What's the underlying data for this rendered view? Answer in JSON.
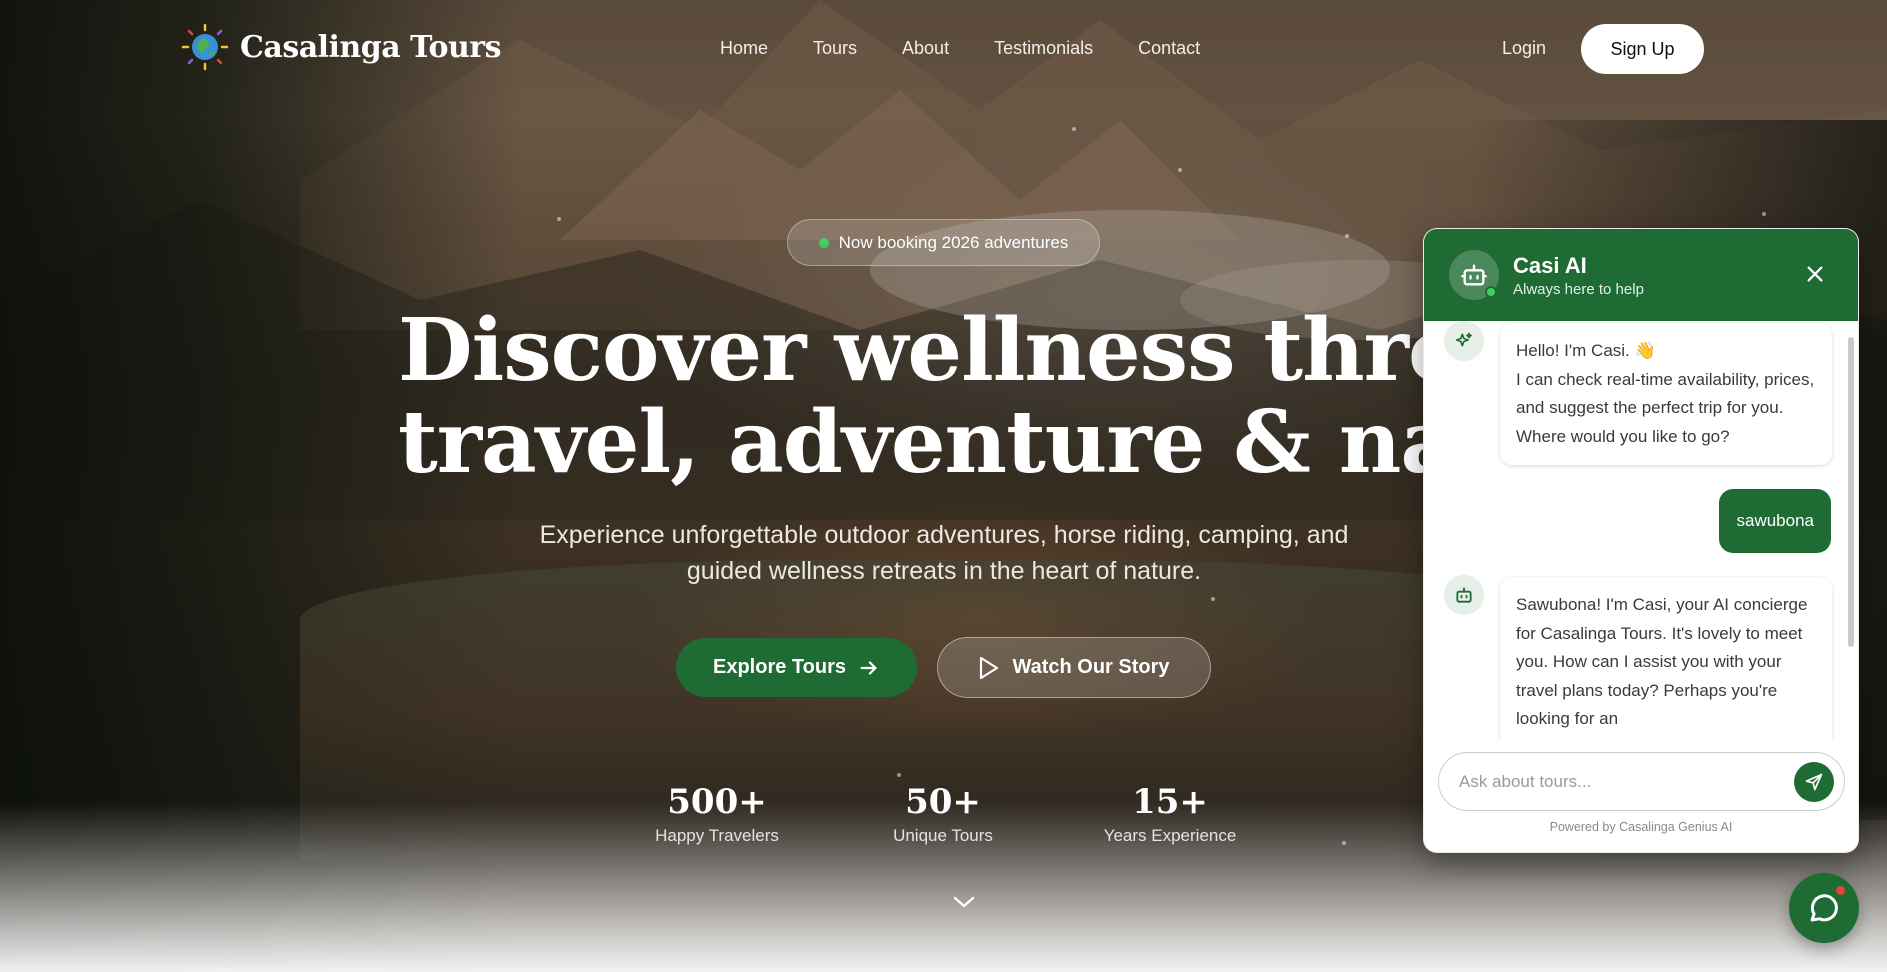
{
  "brand": {
    "name": "Casalinga Tours"
  },
  "nav": {
    "items": [
      "Home",
      "Tours",
      "About",
      "Testimonials",
      "Contact"
    ]
  },
  "auth": {
    "login": "Login",
    "signup": "Sign Up"
  },
  "hero": {
    "badge": "Now booking 2026 adventures",
    "title_line1": "Discover wellness through",
    "title_line2": "travel, adventure & nature",
    "subtitle": "Experience unforgettable outdoor adventures, horse riding, camping, and guided wellness retreats in the heart of nature.",
    "cta_primary": "Explore Tours",
    "cta_secondary": "Watch Our Story"
  },
  "stats": [
    {
      "value": "500+",
      "label": "Happy Travelers"
    },
    {
      "value": "50+",
      "label": "Unique Tours"
    },
    {
      "value": "15+",
      "label": "Years Experience"
    }
  ],
  "chat": {
    "title": "Casi AI",
    "subtitle": "Always here to help",
    "messages": [
      {
        "role": "bot",
        "icon": "sparkles-icon",
        "text": "Hello! I'm Casi. 👋\nI can check real-time availability, prices, and suggest the perfect trip for you. Where would you like to go?"
      },
      {
        "role": "user",
        "text": "sawubona"
      },
      {
        "role": "bot",
        "icon": "bot-icon",
        "text": "Sawubona! I'm Casi, your AI concierge for Casalinga Tours. It's lovely to meet you. How can I assist you with your travel plans today? Perhaps you're looking for an"
      }
    ],
    "input_placeholder": "Ask about tours...",
    "powered_by": "Powered by Casalinga Genius AI"
  },
  "colors": {
    "brand_green": "#1f6b34",
    "online": "#3ccf64",
    "notification": "#e2453c"
  }
}
